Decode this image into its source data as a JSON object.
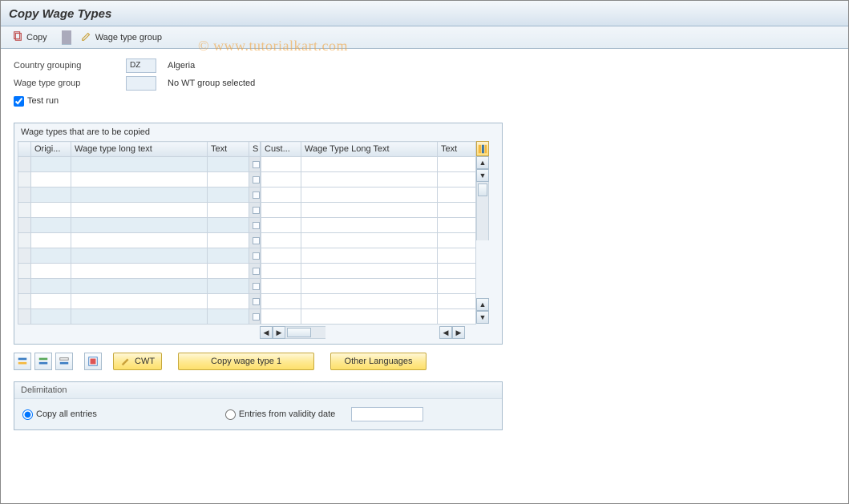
{
  "watermark": "© www.tutorialkart.com",
  "title": "Copy Wage Types",
  "toolbar": {
    "copy": "Copy",
    "wage_type_group": "Wage type group"
  },
  "fields": {
    "country_grouping_label": "Country grouping",
    "country_grouping_value": "DZ",
    "country_grouping_text": "Algeria",
    "wage_type_group_label": "Wage type group",
    "wage_type_group_value": "",
    "wage_type_group_text": "No WT group selected",
    "test_run_label": "Test run",
    "test_run_checked": true
  },
  "grid": {
    "title": "Wage types that are to be copied",
    "left_cols": [
      "Origi...",
      "Wage type long text",
      "Text"
    ],
    "sel_col": "S",
    "right_cols": [
      "Cust...",
      "Wage Type Long Text",
      "Text"
    ],
    "row_count": 11
  },
  "buttons": {
    "cwt": "CWT",
    "copy_wt1": "Copy wage type 1",
    "other_lang": "Other Languages"
  },
  "panel": {
    "title": "Delimitation",
    "opt_all": "Copy all entries",
    "opt_from": "Entries from validity date",
    "date_value": ""
  }
}
